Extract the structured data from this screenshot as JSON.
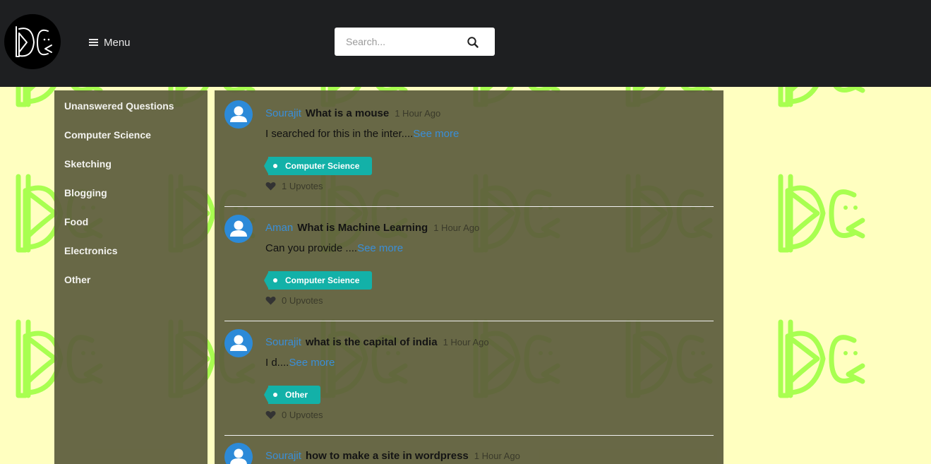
{
  "header": {
    "menu_label": "Menu",
    "search_placeholder": "Search..."
  },
  "sidebar": {
    "items": [
      {
        "label": "Unanswered Questions"
      },
      {
        "label": "Computer Science"
      },
      {
        "label": "Sketching"
      },
      {
        "label": "Blogging"
      },
      {
        "label": "Food"
      },
      {
        "label": "Electronics"
      },
      {
        "label": "Other"
      }
    ]
  },
  "posts": [
    {
      "author": "Sourajit",
      "title": "What is a mouse",
      "time": "1 Hour Ago",
      "excerpt": "I searched for this in the inter....",
      "see_more": "See more",
      "tag": "Computer Science",
      "upvotes": "1 Upvotes"
    },
    {
      "author": "Aman",
      "title": "What is Machine Learning",
      "time": "1 Hour Ago",
      "excerpt": "Can you provide ....",
      "see_more": "See more",
      "tag": "Computer Science",
      "upvotes": "0 Upvotes"
    },
    {
      "author": "Sourajit",
      "title": "what is the capital of india",
      "time": "1 Hour Ago",
      "excerpt": "I d....",
      "see_more": "See more",
      "tag": "Other",
      "upvotes": "0 Upvotes"
    },
    {
      "author": "Sourajit",
      "title": "how to make a site in wordpress",
      "time": "1 Hour Ago"
    }
  ],
  "colors": {
    "navbar": "#1e1f21",
    "page_background": "#ffffc0",
    "pattern": "#a8ff50",
    "panel": "#5c5c3c",
    "link": "#3a8ed8",
    "tag": "#13b1a8"
  },
  "icons": {
    "logo": "dc-logo-icon",
    "menu": "hamburger-icon",
    "search": "search-icon",
    "avatar": "user-icon",
    "upvote": "heart-icon"
  }
}
